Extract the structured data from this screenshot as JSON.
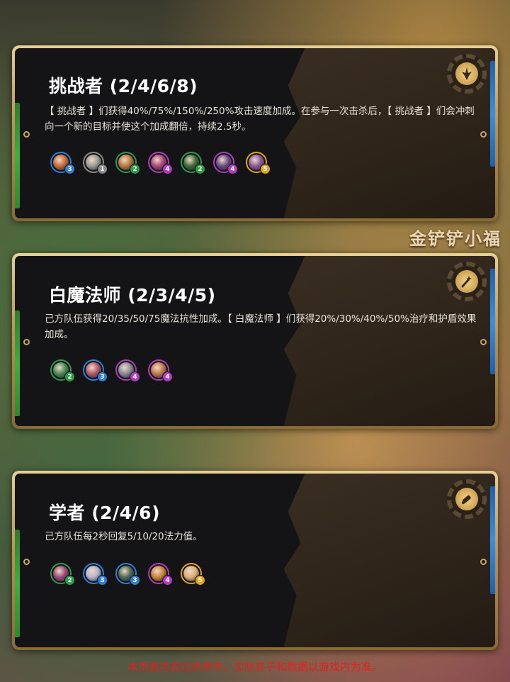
{
  "watermark": "金铲铲小福",
  "footer_note": "本页面内容仅供参考，实际弈子和数据以游戏内为准。",
  "colors": {
    "cost_1": "#8a8a8a",
    "cost_2": "#2e9a4a",
    "cost_3": "#2f7fd6",
    "cost_4": "#b13bbd",
    "cost_5": "#e3a11c",
    "gold_frame": "#c9a866",
    "footer_red": "#e3201c"
  },
  "traits": [
    {
      "title": "挑战者 (2/4/6/8)",
      "icon": "sword-emblem-icon",
      "description": "【 挑战者 】们获得40%/75%/150%/250%攻击速度加成。在参与一次击杀后，【 挑战者 】们会冲刺向一个新的目标并使这个加成翻倍，持续2.5秒。",
      "champions": [
        {
          "cost": "3",
          "tint": "#c86b3a"
        },
        {
          "cost": "1",
          "tint": "#9a9a96"
        },
        {
          "cost": "2",
          "tint": "#b9783a"
        },
        {
          "cost": "4",
          "tint": "#a8477a"
        },
        {
          "cost": "2",
          "tint": "#3f6a3a"
        },
        {
          "cost": "4",
          "tint": "#6b4a8a"
        },
        {
          "cost": "5",
          "tint": "#8a5aa0"
        }
      ]
    },
    {
      "title": "白魔法师 (2/3/4/5)",
      "icon": "magic-wand-icon",
      "description": "己方队伍获得20/35/50/75魔法抗性加成。【 白魔法师 】们获得20%/30%/40%/50%治疗和护盾效果加成。",
      "champions": [
        {
          "cost": "2",
          "tint": "#4a8a5a"
        },
        {
          "cost": "3",
          "tint": "#b05a6a"
        },
        {
          "cost": "4",
          "tint": "#8a8a9a"
        },
        {
          "cost": "4",
          "tint": "#c07a4a"
        }
      ]
    },
    {
      "title": "学者 (2/4/6)",
      "icon": "scroll-icon",
      "description": "己方队伍每2秒回复5/10/20法力值。",
      "champions": [
        {
          "cost": "2",
          "tint": "#9a4a7a"
        },
        {
          "cost": "3",
          "tint": "#b0b4d0"
        },
        {
          "cost": "3",
          "tint": "#4a6a5a"
        },
        {
          "cost": "4",
          "tint": "#c9853a"
        },
        {
          "cost": "5",
          "tint": "#d9b07a"
        }
      ]
    }
  ]
}
